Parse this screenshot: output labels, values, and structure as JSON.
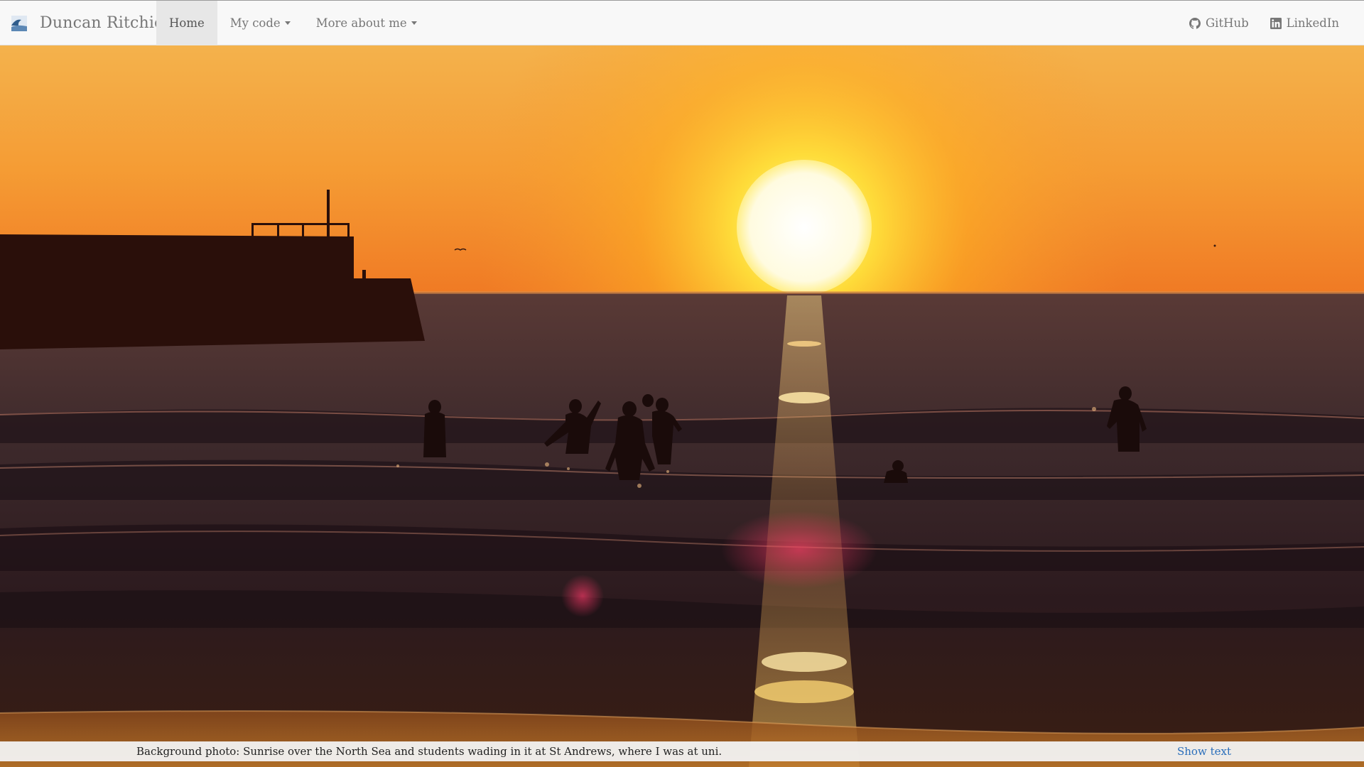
{
  "navbar": {
    "brand_name": "Duncan Ritchie",
    "brand_logo_icon": "wave-photo-icon",
    "left_items": [
      {
        "label": "Home",
        "active": true,
        "dropdown": false
      },
      {
        "label": "My code",
        "active": false,
        "dropdown": true
      },
      {
        "label": "More about me",
        "active": false,
        "dropdown": true
      }
    ],
    "right_items": [
      {
        "label": "GitHub",
        "icon": "github-icon"
      },
      {
        "label": "LinkedIn",
        "icon": "linkedin-icon"
      }
    ]
  },
  "hero": {
    "background_photo": "sunrise-over-sea-photo"
  },
  "caption": {
    "text": "Background photo: Sunrise over the North Sea and students wading in it at St Andrews, where I was at uni.",
    "toggle_label": "Show text"
  },
  "colors": {
    "navbar_bg": "#f8f8f8",
    "active_tab_bg": "#e7e7e7",
    "nav_text": "#777777",
    "link_blue": "#2a6ebb",
    "sky_top": "#f2b14a",
    "sun": "#fffbe8"
  }
}
